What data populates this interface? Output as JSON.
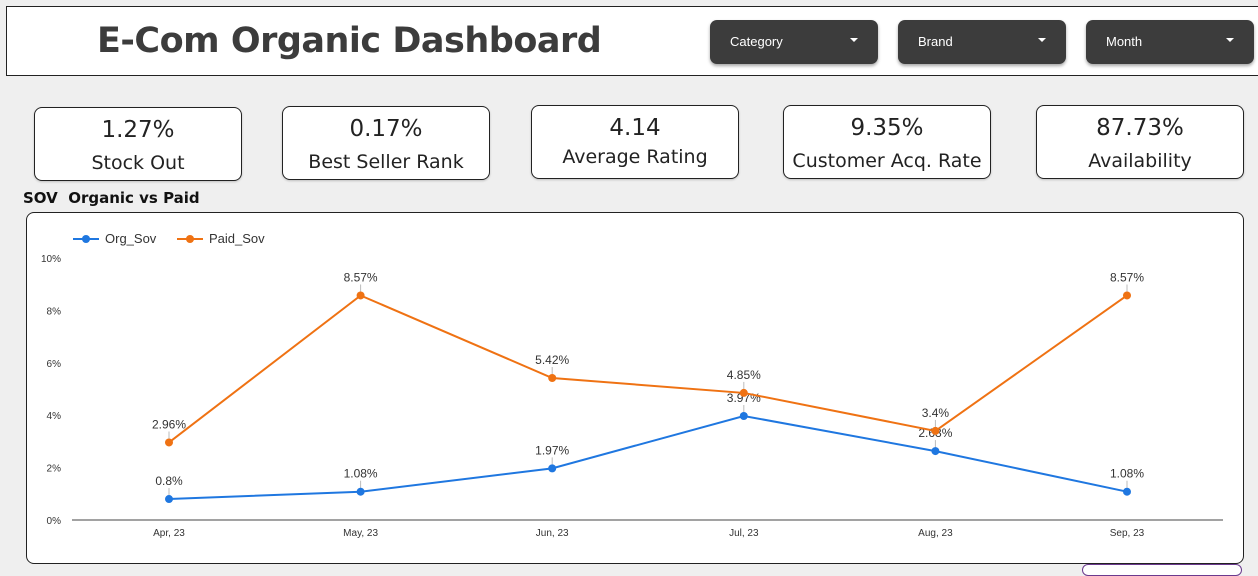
{
  "header": {
    "title": "E-Com Organic Dashboard",
    "filters": [
      {
        "label": "Category"
      },
      {
        "label": "Brand"
      },
      {
        "label": "Month"
      }
    ]
  },
  "kpis": [
    {
      "value": "1.27%",
      "label": "Stock Out"
    },
    {
      "value": "0.17%",
      "label": "Best Seller Rank"
    },
    {
      "value": "4.14",
      "label": "Average Rating"
    },
    {
      "value": "9.35%",
      "label": "Customer Acq. Rate"
    },
    {
      "value": "87.73%",
      "label": "Availability"
    }
  ],
  "section_label": "SOV  Organic vs Paid",
  "colors": {
    "org": "#1f77e0",
    "paid": "#ef7213",
    "dropdown_bg": "#3c3c3c"
  },
  "chart_data": {
    "type": "line",
    "title": "",
    "categories": [
      "Apr, 23",
      "May, 23",
      "Jun, 23",
      "Jul, 23",
      "Aug, 23",
      "Sep, 23"
    ],
    "series": [
      {
        "name": "Org_Sov",
        "values": [
          0.8,
          1.08,
          1.97,
          3.97,
          2.63,
          1.08
        ],
        "labels": [
          "0.8%",
          "1.08%",
          "1.97%",
          "3.97%",
          "2.63%",
          "1.08%"
        ]
      },
      {
        "name": "Paid_Sov",
        "values": [
          2.96,
          8.57,
          5.42,
          4.85,
          3.4,
          8.57
        ],
        "labels": [
          "2.96%",
          "8.57%",
          "5.42%",
          "4.85%",
          "3.4%",
          "8.57%"
        ]
      }
    ],
    "yticks": [
      "0%",
      "2%",
      "4%",
      "6%",
      "8%",
      "10%"
    ],
    "ylim": [
      0,
      10
    ],
    "legend": "top-left",
    "grid": false
  }
}
